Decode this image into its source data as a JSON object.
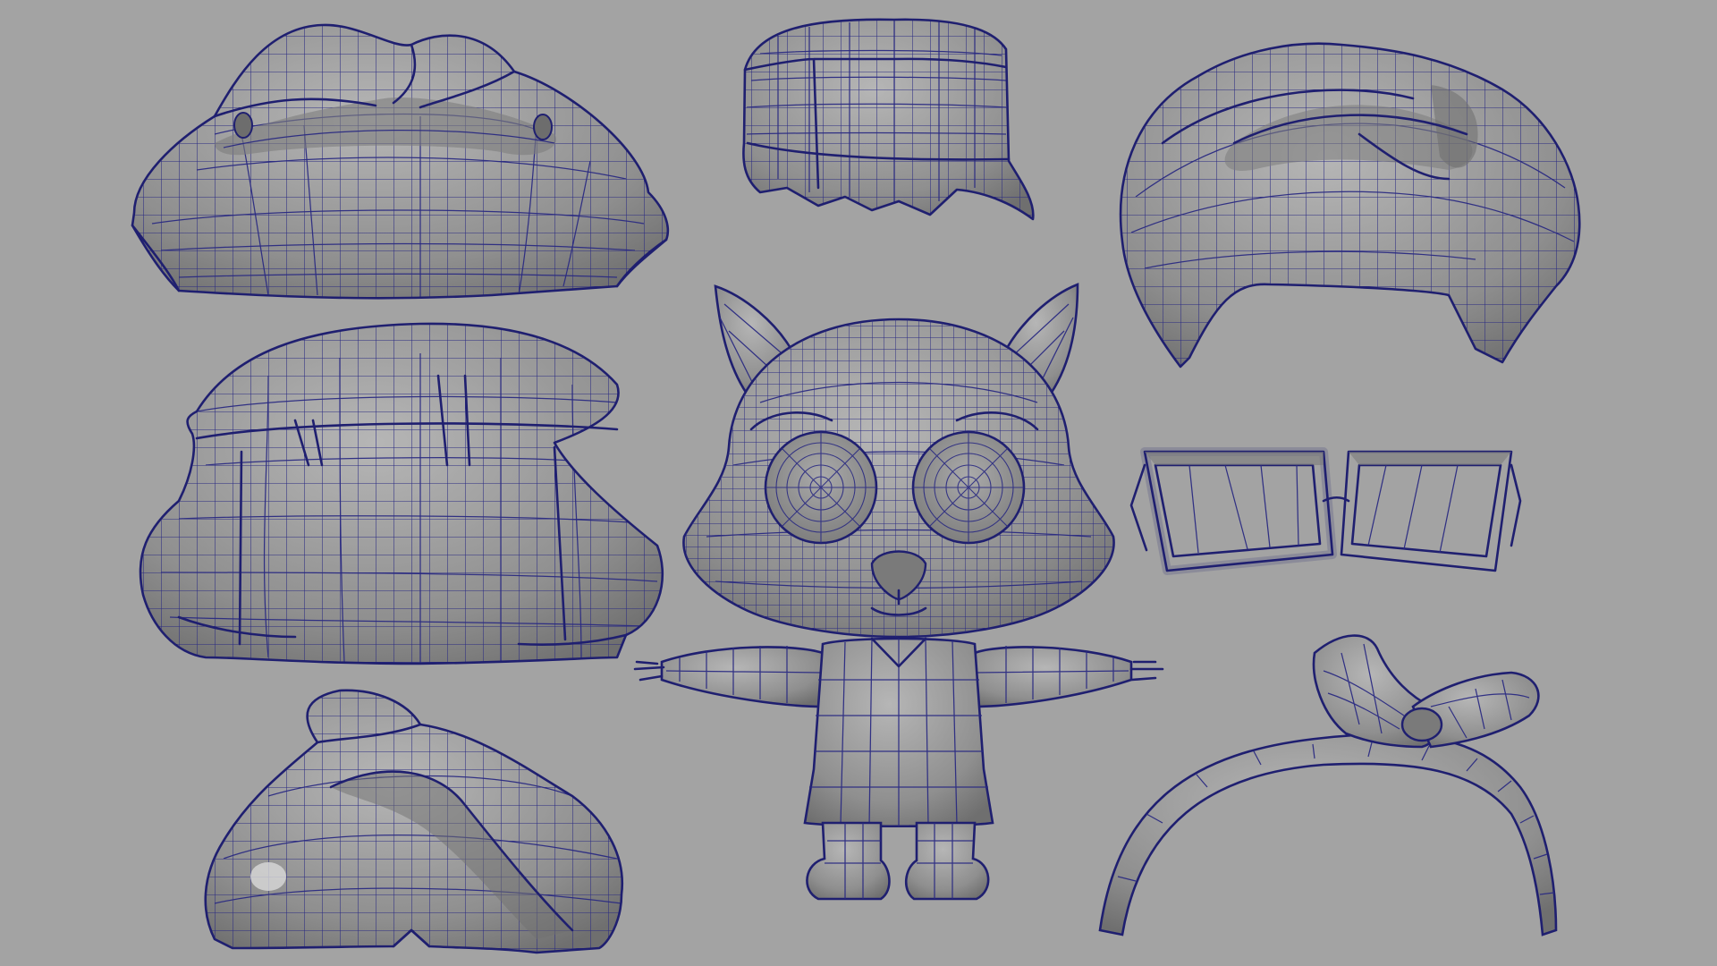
{
  "viewport": {
    "background": "#a3a3a3",
    "wire_color": "#2a2a82",
    "surface_color": "#8e8e8e",
    "display_mode": "wireframe-on-shaded"
  },
  "objects": [
    {
      "id": "hair-mesh-bob-side-flip",
      "kind": "hair"
    },
    {
      "id": "hat-mesh-cap",
      "kind": "hat"
    },
    {
      "id": "hair-mesh-bangs-swoop",
      "kind": "hair"
    },
    {
      "id": "hair-mesh-long-bob",
      "kind": "hair"
    },
    {
      "id": "character-mesh-cat",
      "kind": "body"
    },
    {
      "id": "glasses-mesh-square",
      "kind": "accessory"
    },
    {
      "id": "hair-mesh-bun",
      "kind": "hair"
    },
    {
      "id": "headband-mesh-bow",
      "kind": "accessory"
    }
  ]
}
